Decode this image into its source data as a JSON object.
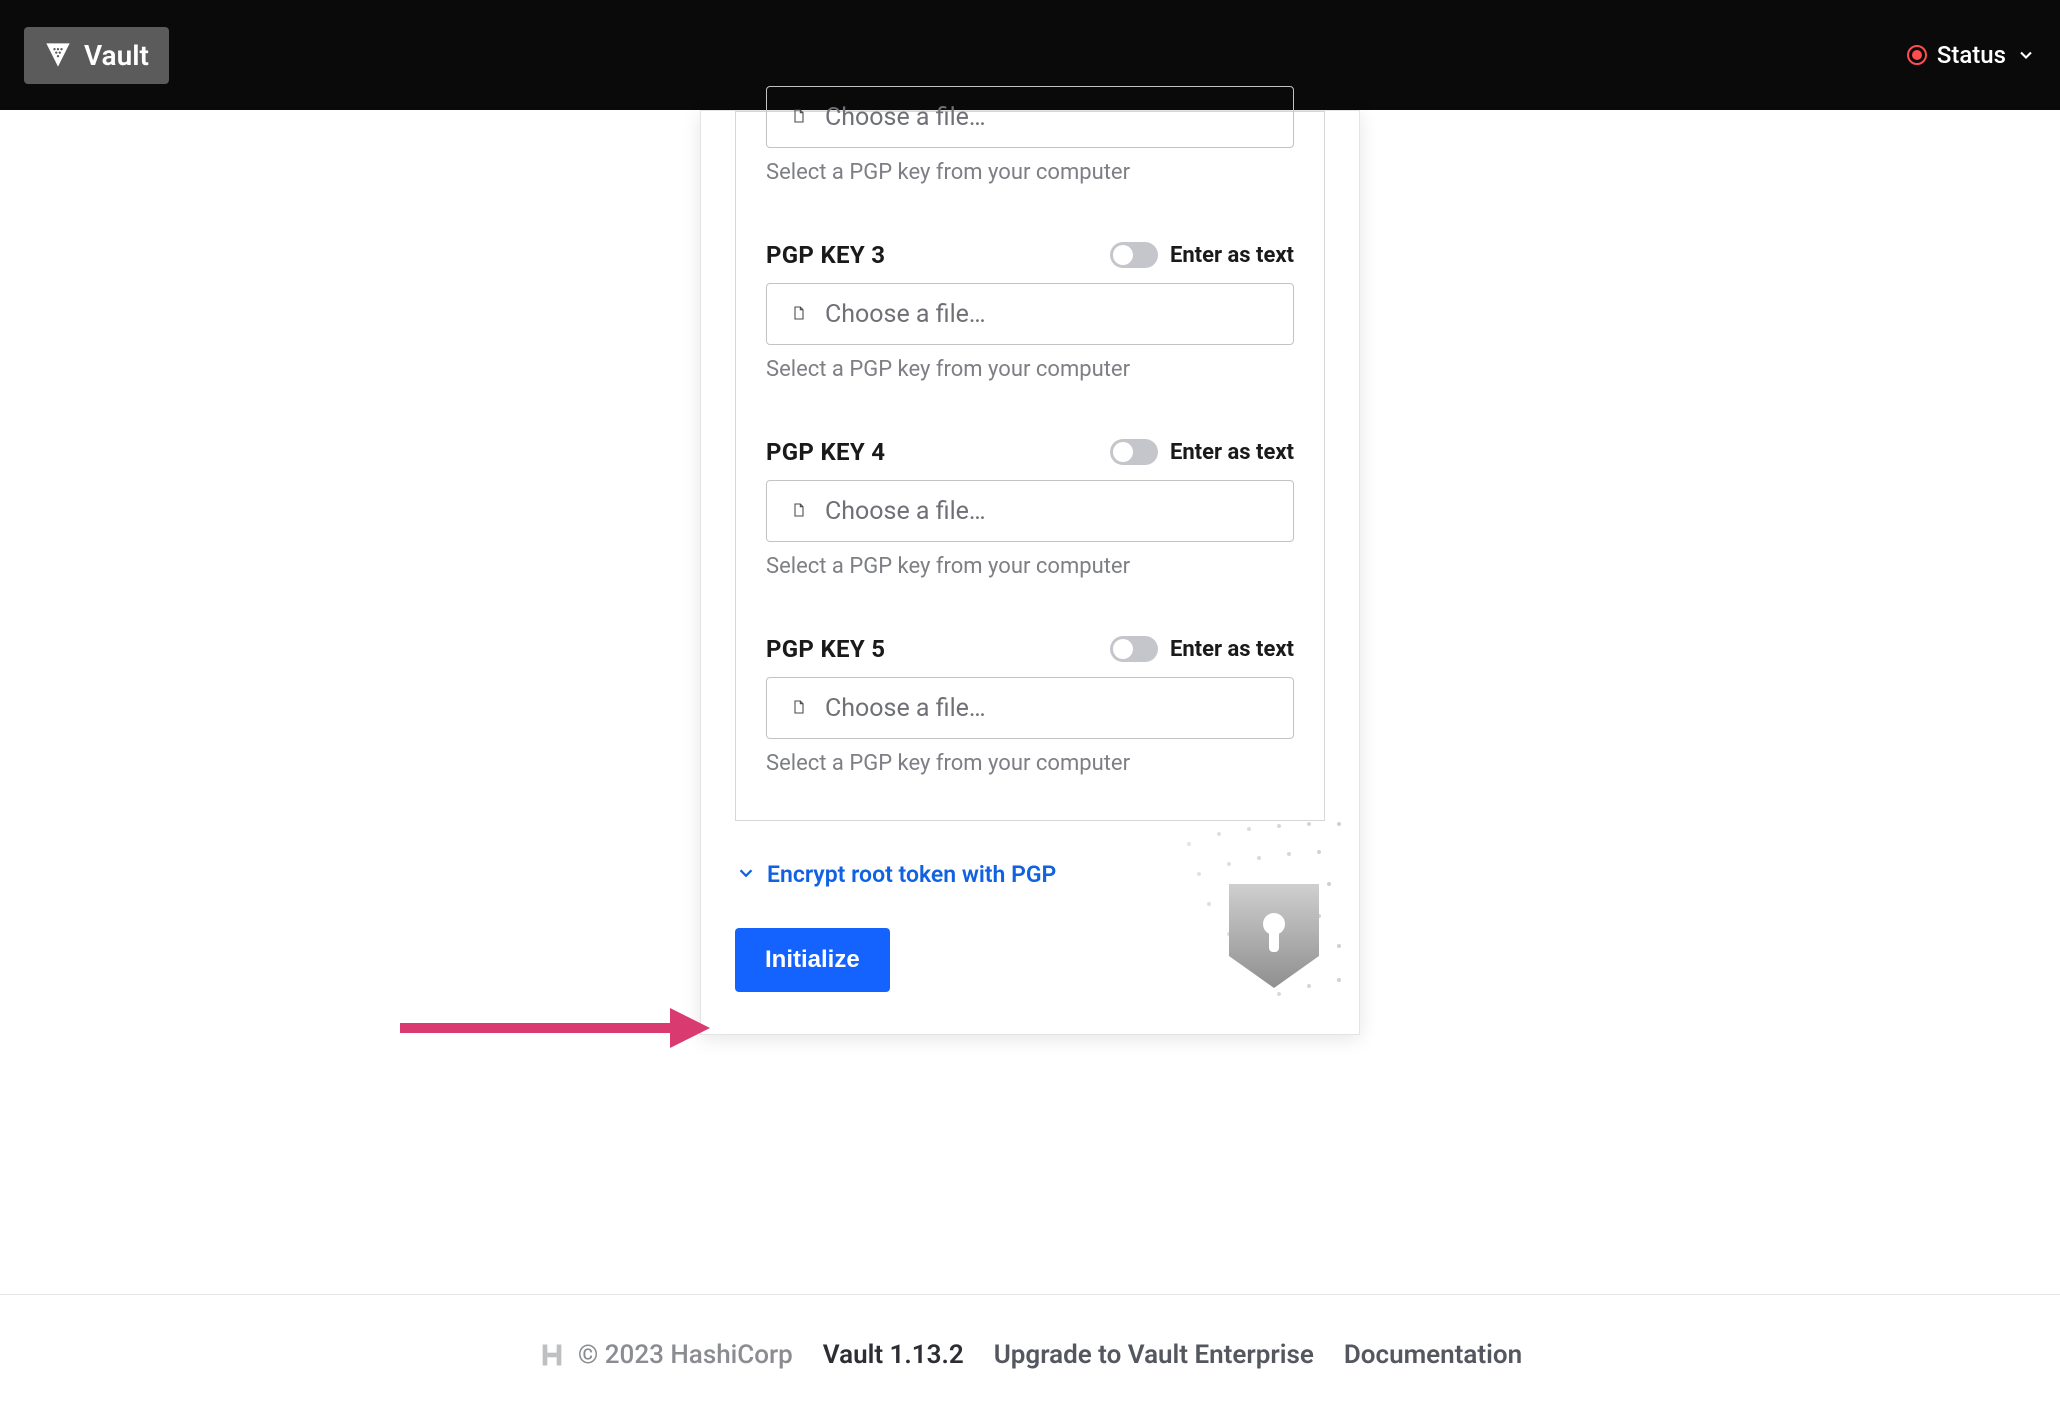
{
  "header": {
    "brand_name": "Vault",
    "status_label": "Status"
  },
  "keys": [
    {
      "label": "",
      "toggle_label": "",
      "file_label": "Choose a file…",
      "help": "Select a PGP key from your computer"
    },
    {
      "label": "PGP KEY 3",
      "toggle_label": "Enter as text",
      "file_label": "Choose a file…",
      "help": "Select a PGP key from your computer"
    },
    {
      "label": "PGP KEY 4",
      "toggle_label": "Enter as text",
      "file_label": "Choose a file…",
      "help": "Select a PGP key from your computer"
    },
    {
      "label": "PGP KEY 5",
      "toggle_label": "Enter as text",
      "file_label": "Choose a file…",
      "help": "Select a PGP key from your computer"
    }
  ],
  "expand_label": "Encrypt root token with PGP",
  "submit_label": "Initialize",
  "footer": {
    "copyright": "© 2023 HashiCorp",
    "version": "Vault 1.13.2",
    "upgrade": "Upgrade to Vault Enterprise",
    "docs": "Documentation"
  }
}
